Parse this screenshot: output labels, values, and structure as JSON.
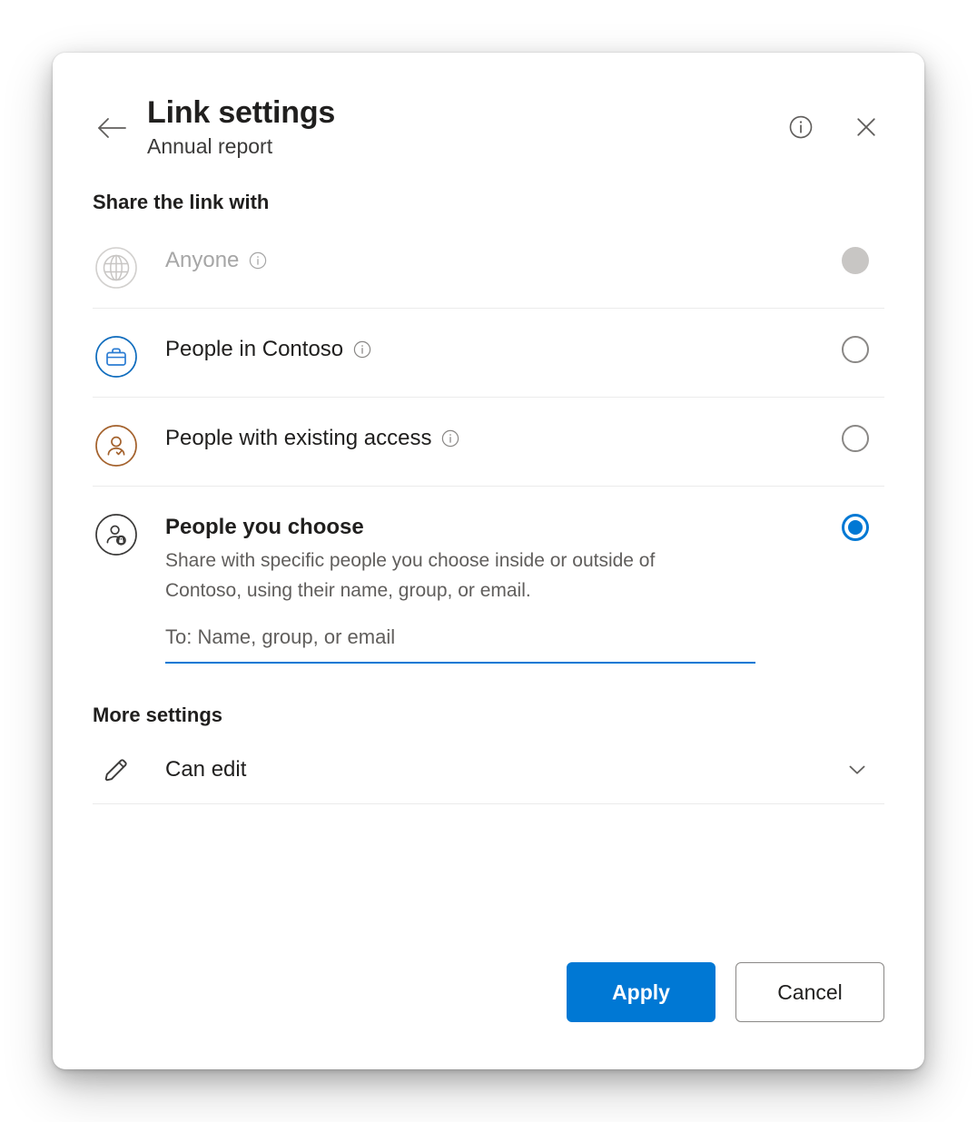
{
  "header": {
    "back_icon": "back-arrow-icon",
    "title": "Link settings",
    "subtitle": "Annual report",
    "info_icon": "info-circle-icon",
    "close_icon": "close-icon"
  },
  "share_section": {
    "label": "Share the link with"
  },
  "options": [
    {
      "id": "anyone",
      "icon": "globe-icon",
      "label": "Anyone",
      "has_info": true,
      "state": "disabled-selected",
      "disabled": true
    },
    {
      "id": "people-in-contoso",
      "icon": "briefcase-icon",
      "label": "People in Contoso",
      "has_info": true,
      "state": "unselected",
      "disabled": false
    },
    {
      "id": "people-with-existing-access",
      "icon": "person-check-icon",
      "label": "People with existing access",
      "has_info": true,
      "state": "unselected",
      "disabled": false
    },
    {
      "id": "people-you-choose",
      "icon": "person-lock-icon",
      "label": "People you choose",
      "description": "Share with specific people you choose inside or outside of Contoso, using their name, group, or email.",
      "has_info": false,
      "state": "selected",
      "disabled": false
    }
  ],
  "recipients_input": {
    "value": "",
    "placeholder": "To: Name, group, or email"
  },
  "more_settings": {
    "label": "More settings",
    "permission_icon": "pencil-icon",
    "permission_value": "Can edit",
    "chevron_icon": "chevron-down-icon"
  },
  "footer": {
    "apply_label": "Apply",
    "cancel_label": "Cancel"
  },
  "colors": {
    "accent_blue": "#0078d4",
    "briefcase_blue": "#0f6cbd",
    "person_brown": "#a4622d",
    "disabled_gray": "#c8c6c4",
    "text_primary": "#201f1e",
    "text_secondary": "#605e5c",
    "divider": "#ebebeb"
  }
}
